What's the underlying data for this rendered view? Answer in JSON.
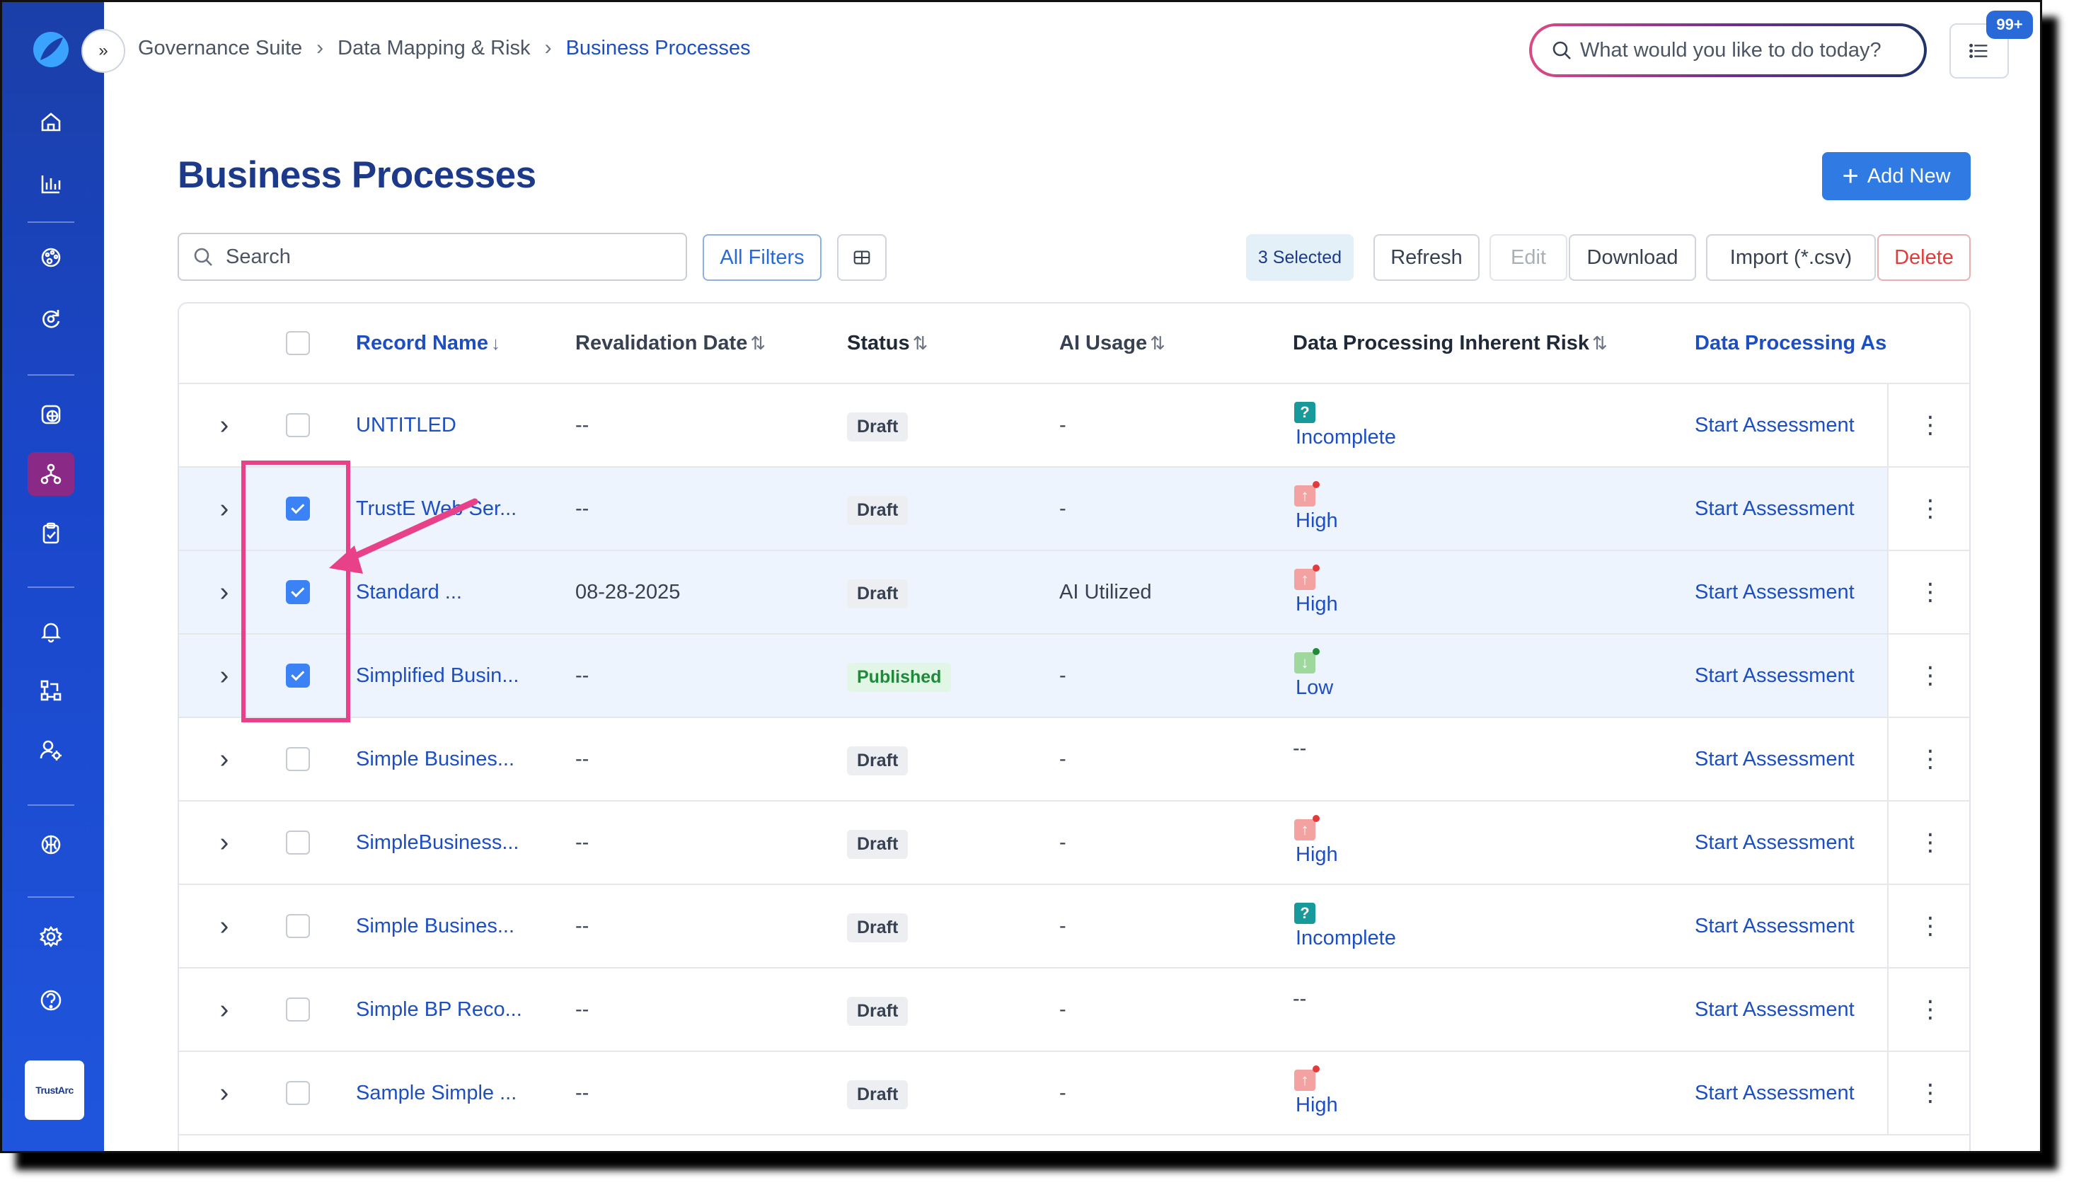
{
  "breadcrumb": {
    "items": [
      "Governance Suite",
      "Data Mapping & Risk",
      "Business Processes"
    ]
  },
  "top_search": {
    "placeholder": "What would you like to do today?"
  },
  "notifications": {
    "badge": "99+"
  },
  "page": {
    "title": "Business Processes",
    "add_new_label": "Add New"
  },
  "toolbar": {
    "search_placeholder": "Search",
    "all_filters": "All Filters",
    "selected": "3 Selected",
    "refresh": "Refresh",
    "edit": "Edit",
    "download": "Download",
    "import": "Import (*.csv)",
    "delete": "Delete"
  },
  "table": {
    "columns": [
      "Record Name",
      "Revalidation Date",
      "Status",
      "AI Usage",
      "Data Processing Inherent Risk",
      "Data Processing As:"
    ],
    "rows": [
      {
        "name": "UNTITLED",
        "date": "--",
        "status": "Draft",
        "ai": "-",
        "risk": "Incomplete",
        "risk_icon": "question-icon",
        "assess": "Start Assessment",
        "selected": false
      },
      {
        "name": "TrustE Web Ser...",
        "date": "--",
        "status": "Draft",
        "ai": "-",
        "risk": "High",
        "risk_icon": "arrow-up-icon",
        "assess": "Start Assessment",
        "selected": true
      },
      {
        "name": "Standard ...",
        "date": "08-28-2025",
        "status": "Draft",
        "ai": "AI Utilized",
        "risk": "High",
        "risk_icon": "arrow-up-icon",
        "assess": "Start Assessment",
        "selected": true
      },
      {
        "name": "Simplified Busin...",
        "date": "--",
        "status": "Published",
        "ai": "-",
        "risk": "Low",
        "risk_icon": "arrow-down-icon",
        "assess": "Start Assessment",
        "selected": true
      },
      {
        "name": "Simple Busines...",
        "date": "--",
        "status": "Draft",
        "ai": "-",
        "risk": "--",
        "risk_icon": "",
        "assess": "Start Assessment",
        "selected": false
      },
      {
        "name": "SimpleBusiness...",
        "date": "--",
        "status": "Draft",
        "ai": "-",
        "risk": "High",
        "risk_icon": "arrow-up-icon",
        "assess": "Start Assessment",
        "selected": false
      },
      {
        "name": "Simple Busines...",
        "date": "--",
        "status": "Draft",
        "ai": "-",
        "risk": "Incomplete",
        "risk_icon": "question-icon",
        "assess": "Start Assessment",
        "selected": false
      },
      {
        "name": "Simple BP Reco...",
        "date": "--",
        "status": "Draft",
        "ai": "-",
        "risk": "--",
        "risk_icon": "",
        "assess": "Start Assessment",
        "selected": false
      },
      {
        "name": "Sample Simple ...",
        "date": "--",
        "status": "Draft",
        "ai": "-",
        "risk": "High",
        "risk_icon": "arrow-up-icon",
        "assess": "Start Assessment",
        "selected": false
      }
    ]
  },
  "sidebar": {
    "items": [
      "home-icon",
      "chart-icon",
      "palette-icon",
      "refresh-shield-icon",
      "globe-grid-icon",
      "org-chart-icon",
      "clipboard-check-icon",
      "bell-icon",
      "flow-icon",
      "user-gear-icon",
      "brain-icon",
      "gear-icon",
      "help-icon"
    ],
    "brand": "TrustArc"
  },
  "colors": {
    "accent": "#2f7be3",
    "brand": "#1b3fa8",
    "annotation": "#e8418a",
    "sidebar_active": "#8b2a86"
  }
}
